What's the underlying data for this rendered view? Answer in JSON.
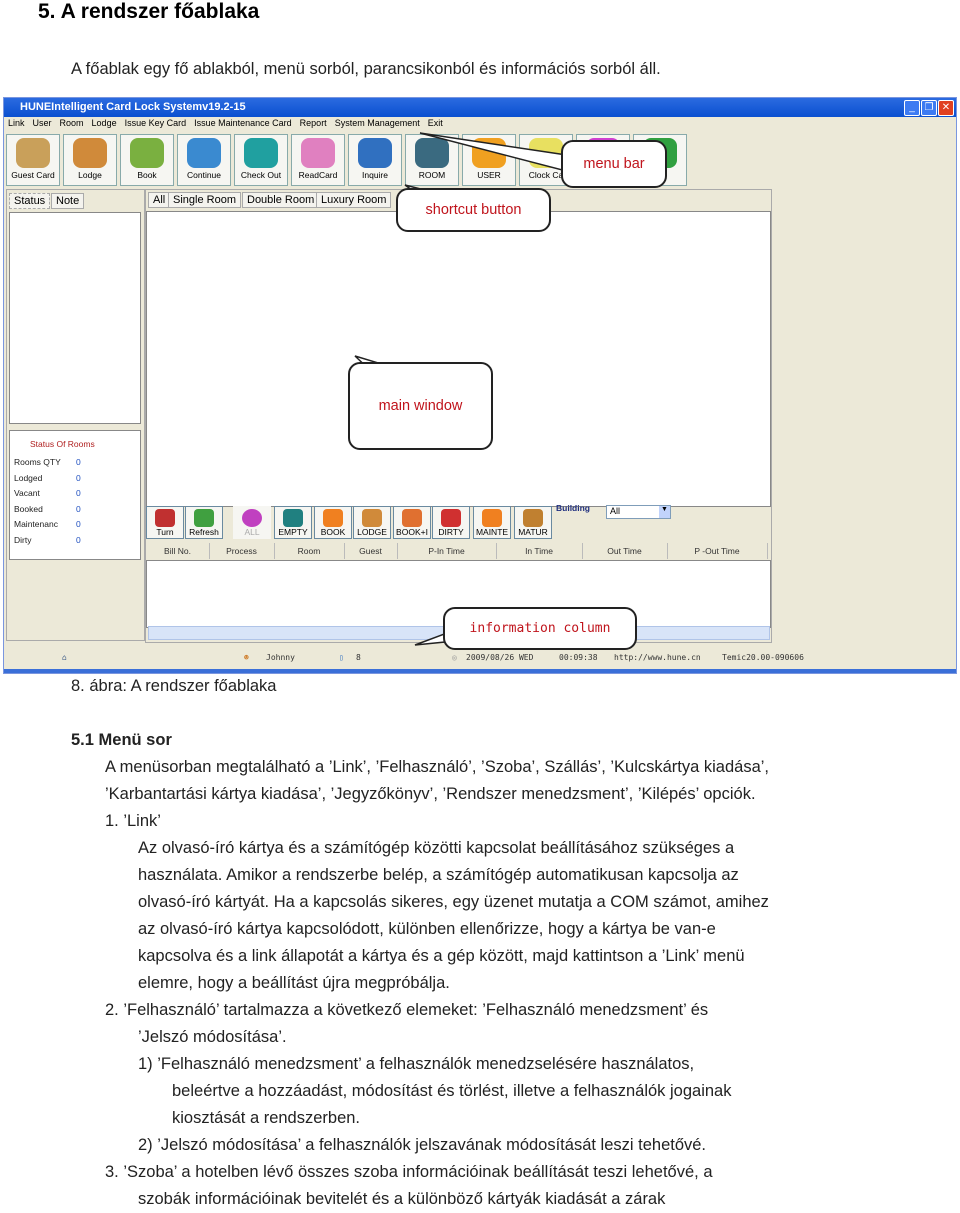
{
  "heading": "5.  A rendszer főablaka",
  "intro": "A főablak egy fő ablakból, menü sorból, parancsikonból és információs sorból áll.",
  "app": {
    "title": "HUNEIntelligent Card Lock Systemv19.2-15",
    "menu": [
      "Link",
      "User",
      "Room",
      "Lodge",
      "Issue Key Card",
      "Issue Maintenance Card",
      "Report",
      "System Management",
      "Exit"
    ],
    "toolbar": [
      {
        "label": "Guest Card",
        "color": "#c9a05a"
      },
      {
        "label": "Lodge",
        "color": "#d08a3a"
      },
      {
        "label": "Book",
        "color": "#7ab040"
      },
      {
        "label": "Continue",
        "color": "#3a8ad0"
      },
      {
        "label": "Check Out",
        "color": "#20a0a0"
      },
      {
        "label": "ReadCard",
        "color": "#e080c0"
      },
      {
        "label": "Inquire",
        "color": "#3070c0"
      },
      {
        "label": "ROOM",
        "color": "#3a6a80"
      },
      {
        "label": "USER",
        "color": "#f0a020"
      },
      {
        "label": "Clock Ca",
        "color": "#e8e060"
      },
      {
        "label": "",
        "color": "#d040d0"
      },
      {
        "label": "",
        "color": "#30a040"
      }
    ],
    "left_tabs": [
      "Status",
      "Note"
    ],
    "room_tabs": [
      "All",
      "Single Room",
      "Double Room",
      "Luxury Room"
    ],
    "status": {
      "title": "Status Of Rooms",
      "rows": [
        {
          "label": "Rooms QTY",
          "value": "0"
        },
        {
          "label": "Lodged",
          "value": "0"
        },
        {
          "label": "Vacant",
          "value": "0"
        },
        {
          "label": "Booked",
          "value": "0"
        },
        {
          "label": "Maintenanc",
          "value": "0"
        },
        {
          "label": "Dirty",
          "value": "0"
        }
      ]
    },
    "bottom_buttons": [
      {
        "label": "Turn",
        "color": "#c03030"
      },
      {
        "label": "Refresh",
        "color": "#40a040"
      },
      {
        "label": "ALL",
        "color": "#c040c0"
      },
      {
        "label": "EMPTY",
        "color": "#208080"
      },
      {
        "label": "BOOK",
        "color": "#f08020"
      },
      {
        "label": "LODGE",
        "color": "#d08a3a"
      },
      {
        "label": "BOOK+I",
        "color": "#e07030"
      },
      {
        "label": "DIRTY",
        "color": "#d03030"
      },
      {
        "label": "MAINTE",
        "color": "#f08020"
      },
      {
        "label": "MATUR",
        "color": "#c08030"
      }
    ],
    "building_label": "Building",
    "building_value": "All",
    "columns": [
      "Bill No.",
      "Process",
      "Room",
      "Guest",
      "P-In Time",
      "In Time",
      "Out Time",
      "P -Out Time"
    ],
    "statusbar": {
      "user": "Johnny",
      "count": "8",
      "date": "2009/08/26  WED",
      "time": "00:09:38",
      "url": "http://www.hune.cn",
      "version": "Temic20.00-090606"
    }
  },
  "callouts": {
    "menu_bar": "menu bar",
    "shortcut": "shortcut button",
    "main": "main window",
    "info": "information column"
  },
  "caption": "8. ábra: A rendszer főablaka",
  "section": "5.1  Menü sor",
  "lines": [
    "A menüsorban megtalálható a ’Link’, ’Felhasználó’, ’Szoba’, Szállás’, ’Kulcskártya kiadása’,",
    "’Karbantartási kártya kiadása’, ’Jegyzőkönyv’, ’Rendszer menedzsment’, ’Kilépés’ opciók.",
    "1.  ’Link’",
    "Az olvasó-író kártya és a számítógép közötti kapcsolat beállításához szükséges a",
    "használata. Amikor a rendszerbe belép, a számítógép automatikusan kapcsolja az",
    "olvasó-író kártyát. Ha a kapcsolás sikeres, egy üzenet mutatja a COM számot, amihez",
    "az olvasó-író kártya kapcsolódott, különben ellenőrizze, hogy a kártya be van-e",
    "kapcsolva és a link állapotát a kártya és a gép között, majd kattintson a ’Link’ menü",
    "elemre, hogy a beállítást újra megpróbálja.",
    "2.  ’Felhasználó’ tartalmazza a következő elemeket: ’Felhasználó menedzsment’ és",
    "’Jelszó módosítása’.",
    "1)  ’Felhasználó menedzsment’ a felhasználók menedzselésére használatos,",
    "beleértve a hozzáadást, módosítást és törlést, illetve a felhasználók jogainak",
    "kiosztását a rendszerben.",
    "2)  ’Jelszó módosítása’ a felhasználók jelszavának módosítását leszi tehetővé.",
    "3.  ’Szoba’ a hotelben lévő összes szoba információinak beállítását teszi lehetővé, a",
    "szobák információinak bevitelét és a különböző kártyák kiadását a zárak"
  ]
}
